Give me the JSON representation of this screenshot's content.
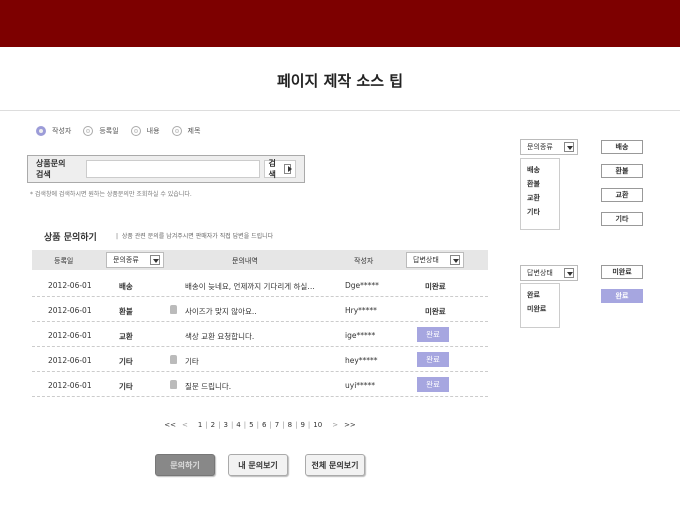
{
  "page_title": "페이지 제작 소스 팁",
  "search_options": [
    {
      "label": "작성자",
      "selected": true
    },
    {
      "label": "등록일",
      "selected": false
    },
    {
      "label": "내용",
      "selected": false
    },
    {
      "label": "제목",
      "selected": false
    }
  ],
  "search": {
    "label": "상품문의 검색",
    "value": "",
    "button": "검색",
    "note": "* 검색창에 검색하시면 원하는 상품문의만 조회하실 수 있습니다."
  },
  "section": {
    "title": "상품 문의하기",
    "subtitle": "상품 관련 문의를 남겨주시면 판매자가 직접 답변을 드립니다"
  },
  "table": {
    "headers": {
      "date": "등록일",
      "type": "문의종류",
      "content": "문의내역",
      "author": "작성자",
      "status": "답변상태"
    },
    "rows": [
      {
        "date": "2012-06-01",
        "type": "배송",
        "locked": false,
        "content": "배송이 늦네요, 언제까지 기다리게 하실…",
        "author": "Dge*****",
        "status": "미완료"
      },
      {
        "date": "2012-06-01",
        "type": "환불",
        "locked": true,
        "content": "사이즈가 맞지 않아요..",
        "author": "Hry*****",
        "status": "미완료"
      },
      {
        "date": "2012-06-01",
        "type": "교환",
        "locked": false,
        "content": "색상 교환 요청합니다.",
        "author": "ige*****",
        "status": "완료"
      },
      {
        "date": "2012-06-01",
        "type": "기타",
        "locked": true,
        "content": "기타",
        "author": "hey*****",
        "status": "완료"
      },
      {
        "date": "2012-06-01",
        "type": "기타",
        "locked": true,
        "content": "질문 드립니다.",
        "author": "uyi*****",
        "status": "완료"
      }
    ]
  },
  "pagination": {
    "first": "<<",
    "prev": "<",
    "pages": [
      "1",
      "2",
      "3",
      "4",
      "5",
      "6",
      "7",
      "8",
      "9",
      "10"
    ],
    "next": ">",
    "last": ">>"
  },
  "buttons": {
    "ask": "문의하기",
    "mine": "내 문의보기",
    "all": "전체 문의보기"
  },
  "side": {
    "type_select": "문의종류",
    "type_options": [
      "배송",
      "환불",
      "교환",
      "기타"
    ],
    "type_buttons": [
      "배송",
      "환불",
      "교환",
      "기타"
    ],
    "status_select": "답변상태",
    "status_options": [
      "완료",
      "미완료"
    ],
    "status_buttons": [
      "미완료",
      "완료"
    ]
  },
  "colors": {
    "header": "#7d0000",
    "done": "#a6a6e0"
  }
}
